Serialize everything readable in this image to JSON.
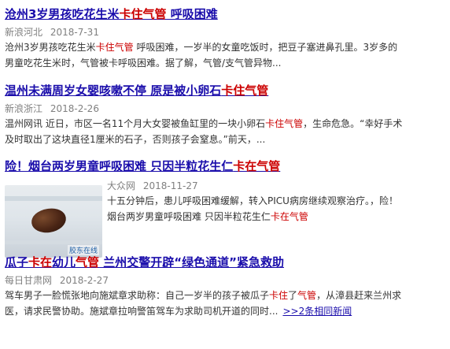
{
  "results": [
    {
      "title_parts": [
        {
          "text": "沧州3岁男孩吃花生米",
          "hl": false
        },
        {
          "text": "卡住气管",
          "hl": true
        },
        {
          "text": " 呼吸困难",
          "hl": false
        }
      ],
      "source": "新浪河北",
      "date": "2018-7-31",
      "summary_lines": [
        [
          {
            "text": "沧州3岁男孩吃花生米",
            "hl": false
          },
          {
            "text": "卡住气管",
            "hl": true
          },
          {
            "text": " 呼吸困难，一岁半的女童吃饭时，把豆子塞进鼻孔里。3岁多的",
            "hl": false
          }
        ],
        [
          {
            "text": "男童吃花生米时，气管被卡呼吸困难。据了解，气管/支气管异物...",
            "hl": false
          }
        ]
      ]
    },
    {
      "title_parts": [
        {
          "text": "温州未满周岁女婴咳嗽不停 原是被小卵石",
          "hl": false
        },
        {
          "text": "卡住气管",
          "hl": true
        }
      ],
      "source": "新浪浙江",
      "date": "2018-2-26",
      "summary_lines": [
        [
          {
            "text": "温州网讯 近日，市区一名11个月大女婴被鱼缸里的一块小卵石",
            "hl": false
          },
          {
            "text": "卡住气管",
            "hl": true
          },
          {
            "text": "，生命危急。“幸好手术",
            "hl": false
          }
        ],
        [
          {
            "text": "及时取出了这块直径1厘米的石子，否则孩子会窒息。”前天，...",
            "hl": false
          }
        ]
      ]
    },
    {
      "title_parts": [
        {
          "text": "险！烟台两岁男童呼吸困难 只因半粒花生仁",
          "hl": false
        },
        {
          "text": "卡在气管",
          "hl": true
        }
      ],
      "source": "大众网",
      "date": "2018-11-27",
      "thumb_watermark": "胶东在线",
      "summary_lines": [
        [
          {
            "text": "十五分钟后，患儿呼吸困难缓解，转入PICU病房继续观察治疗。，险！",
            "hl": false
          }
        ],
        [
          {
            "text": "烟台两岁男童呼吸困难 只因半粒花生仁",
            "hl": false
          },
          {
            "text": "卡在气管",
            "hl": true
          }
        ]
      ]
    },
    {
      "title_parts": [
        {
          "text": "瓜子",
          "hl": false
        },
        {
          "text": "卡在",
          "hl": true
        },
        {
          "text": "幼儿",
          "hl": false
        },
        {
          "text": "气管",
          "hl": true
        },
        {
          "text": " 兰州交警开辟“绿色通道”紧急救助",
          "hl": false
        }
      ],
      "source": "每日甘肃网",
      "date": "2018-2-27",
      "summary_lines": [
        [
          {
            "text": "驾车男子一脸慌张地向施斌章求助称：自己一岁半的孩子被瓜子",
            "hl": false
          },
          {
            "text": "卡住",
            "hl": true
          },
          {
            "text": "了",
            "hl": false
          },
          {
            "text": "气管",
            "hl": true
          },
          {
            "text": "，从漳县赶来兰州求",
            "hl": false
          }
        ],
        [
          {
            "text": "医，请求民警协助。施斌章拉响警笛驾车为求助司机开道的同时...",
            "hl": false
          }
        ]
      ],
      "related_link": ">>2条相同新闻"
    }
  ]
}
